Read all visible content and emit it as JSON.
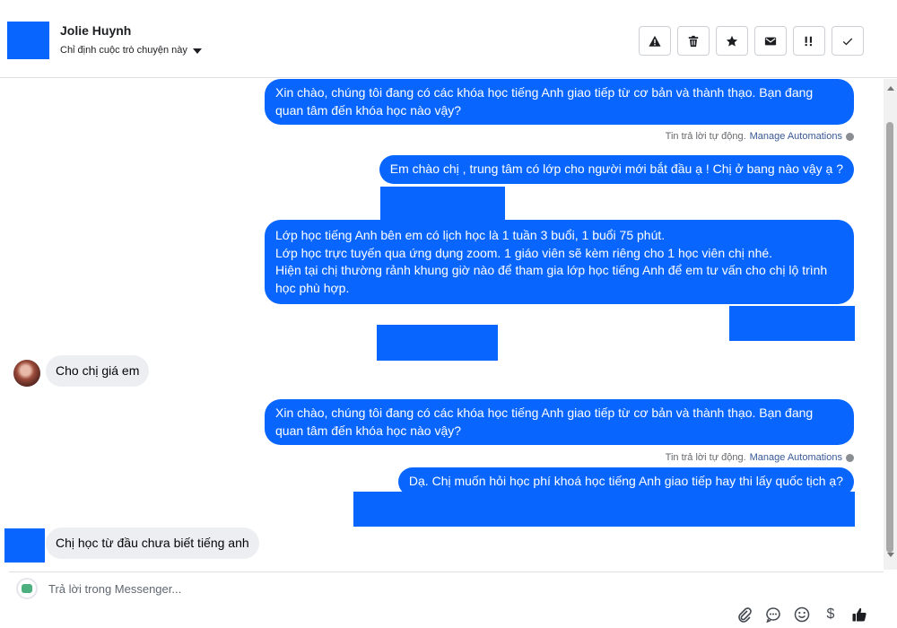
{
  "header": {
    "name": "Jolie Huynh",
    "assign_label": "Chỉ định cuộc trò chuyện này",
    "actions": [
      {
        "icon": "alert-icon",
        "label": "Mark as spam"
      },
      {
        "icon": "trash-icon",
        "label": "Delete"
      },
      {
        "icon": "star-icon",
        "label": "Star"
      },
      {
        "icon": "mail-icon",
        "label": "Mark as unread"
      },
      {
        "icon": "follow-up-icon",
        "label": "Follow up"
      },
      {
        "icon": "check-icon",
        "label": "Mark as done"
      }
    ]
  },
  "thread": {
    "messages": [
      {
        "dir": "out",
        "text": "Xin chào, chúng tôi đang có các khóa học tiếng Anh giao tiếp từ cơ bản và thành thạo. Bạn đang quan tâm đến khóa học nào vậy?"
      },
      {
        "dir": "meta",
        "text": "Tin trả lời tự động.",
        "link": "Manage Automations"
      },
      {
        "dir": "out",
        "text": "Em chào chị , trung tâm có lớp cho người mới bắt đầu ạ ! Chị ở bang nào vậy ạ ?"
      },
      {
        "dir": "out",
        "text": "Lớp học tiếng Anh bên em có lịch học là 1 tuần 3 buổi, 1 buổi 75 phút.\nLớp học trực tuyến qua ứng dụng zoom. 1 giáo viên sẽ kèm riêng cho 1 học viên chị nhé.\nHiện tại chị thường rảnh khung giờ nào để tham gia lớp học tiếng Anh để em tư vấn cho chị lộ trình học phù hợp."
      },
      {
        "dir": "in",
        "text": "Cho chị giá em"
      },
      {
        "dir": "out",
        "text": "Xin chào, chúng tôi đang có các khóa học tiếng Anh giao tiếp từ cơ bản và thành thạo. Bạn đang quan tâm đến khóa học nào vậy?"
      },
      {
        "dir": "meta",
        "text": "Tin trả lời tự động.",
        "link": "Manage Automations"
      },
      {
        "dir": "out",
        "text": "Dạ. Chị muốn hỏi học phí khoá học tiếng Anh giao tiếp hay thi lấy quốc tịch ạ?"
      },
      {
        "dir": "in",
        "text": "Chị học từ đầu chưa biết tiếng anh"
      }
    ]
  },
  "composer": {
    "placeholder": "Trả lời trong Messenger...",
    "actions": [
      "paperclip-icon",
      "chat-bubble-icon",
      "emoji-icon",
      "dollar-icon",
      "thumbs-up-icon"
    ],
    "dollar_glyph": "$"
  },
  "colors": {
    "accent": "#0866ff",
    "incoming_bubble": "#eceef1",
    "link": "#385898"
  }
}
